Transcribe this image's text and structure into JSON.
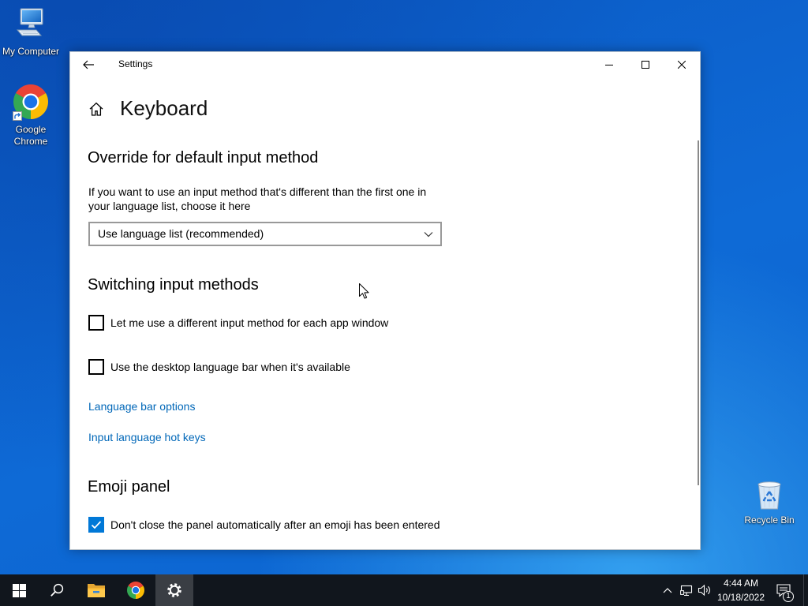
{
  "desktop": {
    "icons": [
      {
        "label": "My Computer",
        "icon": "computer-icon"
      },
      {
        "label": "Google Chrome",
        "icon": "chrome-icon"
      },
      {
        "label": "Recycle Bin",
        "icon": "recycle-bin-icon"
      }
    ]
  },
  "window": {
    "title": "Settings",
    "back_icon": "back-arrow-icon",
    "controls": [
      "minimize-icon",
      "maximize-icon",
      "close-icon"
    ],
    "page": {
      "icon": "home-icon",
      "title": "Keyboard"
    },
    "sections": {
      "override": {
        "heading": "Override for default input method",
        "description": "If you want to use an input method that's different than the first one in your language list, choose it here",
        "dropdown": {
          "selected": "Use language list (recommended)",
          "icon": "chevron-down-icon"
        }
      },
      "switching": {
        "heading": "Switching input methods",
        "options": [
          {
            "label": "Let me use a different input method for each app window",
            "checked": false
          },
          {
            "label": "Use the desktop language bar when it's available",
            "checked": false
          }
        ],
        "links": [
          "Language bar options",
          "Input language hot keys"
        ]
      },
      "emoji": {
        "heading": "Emoji panel",
        "options": [
          {
            "label": "Don't close the panel automatically after an emoji has been entered",
            "checked": true
          }
        ]
      }
    }
  },
  "taskbar": {
    "buttons": [
      "windows-logo-icon",
      "search-icon",
      "file-explorer-icon",
      "chrome-icon",
      "settings-gear-icon"
    ],
    "active": "settings-gear-icon",
    "tray_icons": [
      "chevron-up-icon",
      "network-icon",
      "volume-icon"
    ],
    "clock": {
      "time": "4:44 AM",
      "date": "10/18/2022"
    },
    "notifications": {
      "icon": "action-center-icon",
      "badge": "1"
    }
  },
  "colors": {
    "accent": "#0078d7",
    "link": "#0067b8",
    "taskbar": "#11161d",
    "active_taskbar_button": "#3a3e44"
  }
}
